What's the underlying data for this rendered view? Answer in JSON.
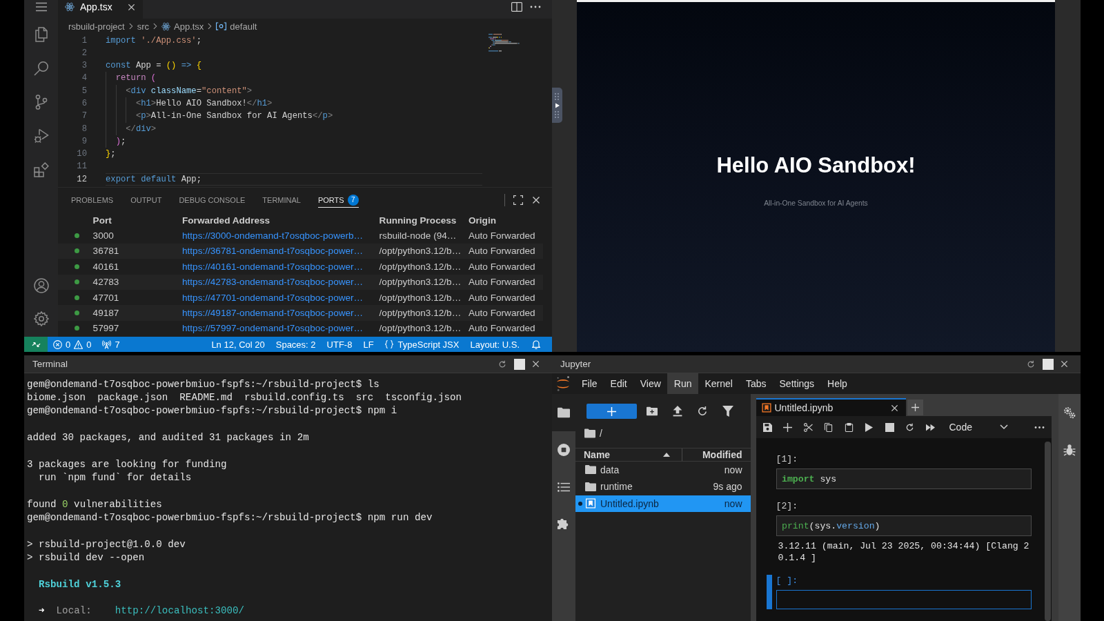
{
  "vscode": {
    "editor_tabs": [
      {
        "label": "App.tsx",
        "selected": true
      }
    ],
    "breadcrumb": [
      {
        "text": "rsbuild-project",
        "kind": "folder"
      },
      {
        "text": "src",
        "kind": "folder"
      },
      {
        "text": "App.tsx",
        "kind": "file"
      },
      {
        "text": "default",
        "kind": "symbol"
      }
    ],
    "code_lines": [
      {
        "number": "1",
        "current": false,
        "tokens": [
          {
            "text": "import",
            "kind": "keyword"
          },
          {
            "text": " './App.css'",
            "kind": "string"
          },
          {
            "text": ";",
            "kind": "plain"
          }
        ]
      },
      {
        "number": "2",
        "current": false
      },
      {
        "number": "3",
        "current": false,
        "tokens": [
          {
            "text": "const",
            "kind": "keyword"
          },
          {
            "text": " App = ",
            "kind": "plain"
          },
          {
            "text": "()",
            "kind": "bracket1"
          },
          {
            "text": " =>",
            "kind": "keyword"
          },
          {
            "text": " {",
            "kind": "bracket1"
          }
        ]
      },
      {
        "number": "4",
        "current": false,
        "tokens": [
          {
            "text": "  return",
            "kind": "control"
          },
          {
            "text": " (",
            "kind": "bracket2"
          }
        ]
      },
      {
        "number": "5",
        "current": false,
        "tokens": [
          {
            "text": "    <",
            "kind": "angle"
          },
          {
            "text": "div",
            "kind": "tag"
          },
          {
            "text": " className",
            "kind": "attr"
          },
          {
            "text": "=",
            "kind": "plain"
          },
          {
            "text": "\"content\"",
            "kind": "string"
          },
          {
            "text": ">",
            "kind": "angle"
          }
        ]
      },
      {
        "number": "6",
        "current": false,
        "tokens": [
          {
            "text": "      <",
            "kind": "angle"
          },
          {
            "text": "h1",
            "kind": "tag"
          },
          {
            "text": ">",
            "kind": "angle"
          },
          {
            "text": "Hello AIO Sandbox!",
            "kind": "plain"
          },
          {
            "text": "</",
            "kind": "angle"
          },
          {
            "text": "h1",
            "kind": "tag"
          },
          {
            "text": ">",
            "kind": "angle"
          }
        ]
      },
      {
        "number": "7",
        "current": false,
        "tokens": [
          {
            "text": "      <",
            "kind": "angle"
          },
          {
            "text": "p",
            "kind": "tag"
          },
          {
            "text": ">",
            "kind": "angle"
          },
          {
            "text": "All-in-One Sandbox for AI Agents",
            "kind": "plain"
          },
          {
            "text": "</",
            "kind": "angle"
          },
          {
            "text": "p",
            "kind": "tag"
          },
          {
            "text": ">",
            "kind": "angle"
          }
        ]
      },
      {
        "number": "8",
        "current": false,
        "tokens": [
          {
            "text": "    </",
            "kind": "angle"
          },
          {
            "text": "div",
            "kind": "tag"
          },
          {
            "text": ">",
            "kind": "angle"
          }
        ]
      },
      {
        "number": "9",
        "current": false,
        "tokens": [
          {
            "text": "  )",
            "kind": "bracket2"
          },
          {
            "text": ";",
            "kind": "plain"
          }
        ]
      },
      {
        "number": "10",
        "current": false,
        "tokens": [
          {
            "text": "}",
            "kind": "bracket1"
          },
          {
            "text": ";",
            "kind": "plain"
          }
        ]
      },
      {
        "number": "11",
        "current": false
      },
      {
        "number": "12",
        "current": true,
        "tokens": [
          {
            "text": "export default",
            "kind": "keyword"
          },
          {
            "text": " App;",
            "kind": "plain"
          }
        ]
      }
    ],
    "panel_tabs": [
      {
        "label": "PROBLEMS",
        "selected": false
      },
      {
        "label": "OUTPUT",
        "selected": false
      },
      {
        "label": "DEBUG CONSOLE",
        "selected": false
      },
      {
        "label": "TERMINAL",
        "selected": false
      },
      {
        "label": "PORTS",
        "selected": true,
        "badge": "7"
      }
    ],
    "ports_table": {
      "columns": [
        "Port",
        "Forwarded Address",
        "Running Process",
        "Origin"
      ],
      "rows": [
        {
          "port": "3000",
          "forwarded_address": "https://3000-ondemand-t7osqboc-powerb…",
          "running_process": "rsbuild-node (94…",
          "origin": "Auto Forwarded"
        },
        {
          "port": "36781",
          "forwarded_address": "https://36781-ondemand-t7osqboc-power…",
          "running_process": "/opt/python3.12/b…",
          "origin": "Auto Forwarded"
        },
        {
          "port": "40161",
          "forwarded_address": "https://40161-ondemand-t7osqboc-power…",
          "running_process": "/opt/python3.12/b…",
          "origin": "Auto Forwarded"
        },
        {
          "port": "42783",
          "forwarded_address": "https://42783-ondemand-t7osqboc-power…",
          "running_process": "/opt/python3.12/b…",
          "origin": "Auto Forwarded"
        },
        {
          "port": "47701",
          "forwarded_address": "https://47701-ondemand-t7osqboc-power…",
          "running_process": "/opt/python3.12/b…",
          "origin": "Auto Forwarded"
        },
        {
          "port": "49187",
          "forwarded_address": "https://49187-ondemand-t7osqboc-power…",
          "running_process": "/opt/python3.12/b…",
          "origin": "Auto Forwarded"
        },
        {
          "port": "57997",
          "forwarded_address": "https://57997-ondemand-t7osqboc-power…",
          "running_process": "/opt/python3.12/b…",
          "origin": "Auto Forwarded"
        }
      ]
    },
    "status_bar": {
      "errors": "0",
      "warnings": "0",
      "ports": "7",
      "items": [
        {
          "text": "Ln 12, Col 20",
          "kind": "plain"
        },
        {
          "text": "Spaces: 2",
          "kind": "plain"
        },
        {
          "text": "UTF-8",
          "kind": "plain"
        },
        {
          "text": "LF",
          "kind": "plain"
        },
        {
          "text": "TypeScript JSX",
          "kind": "language"
        },
        {
          "text": "Layout: U.S.",
          "kind": "plain"
        }
      ]
    }
  },
  "preview": {
    "heading": "Hello AIO Sandbox!",
    "subtitle": "All-in-One Sandbox for AI Agents"
  },
  "terminal": {
    "title": "Terminal",
    "blocks": [
      {
        "lines": [
          {
            "segments": [
              {
                "text": "gem@ondemand-t7osqboc-powerbmiuo-fspfs:~/rsbuild-project$ ls",
                "kind": "plain"
              }
            ]
          },
          {
            "segments": [
              {
                "text": "biome.json  package.json  README.md  rsbuild.config.ts  src  tsconfig.json",
                "kind": "plain"
              }
            ]
          },
          {
            "segments": [
              {
                "text": "gem@ondemand-t7osqboc-powerbmiuo-fspfs:~/rsbuild-project$ npm i",
                "kind": "plain"
              }
            ]
          }
        ]
      },
      {
        "lines": [
          {
            "segments": [
              {
                "text": "added 30 packages, and audited 31 packages in 2m",
                "kind": "plain"
              }
            ]
          }
        ]
      },
      {
        "lines": [
          {
            "segments": [
              {
                "text": "3 packages are looking for funding",
                "kind": "plain"
              }
            ]
          },
          {
            "segments": [
              {
                "text": "  run `npm fund` for details",
                "kind": "plain"
              }
            ]
          }
        ]
      },
      {
        "lines": [
          {
            "segments": [
              {
                "text": "found ",
                "kind": "plain"
              },
              {
                "text": "0",
                "kind": "number"
              },
              {
                "text": " vulnerabilities",
                "kind": "plain"
              }
            ]
          },
          {
            "segments": [
              {
                "text": "gem@ondemand-t7osqboc-powerbmiuo-fspfs:~/rsbuild-project$ npm run dev",
                "kind": "plain"
              }
            ]
          }
        ]
      },
      {
        "lines": [
          {
            "segments": [
              {
                "text": "> rsbuild-project@1.0.0 dev",
                "kind": "plain"
              }
            ]
          },
          {
            "segments": [
              {
                "text": "> rsbuild dev --open",
                "kind": "plain"
              }
            ]
          }
        ]
      },
      {
        "lines": [
          {
            "segments": [
              {
                "text": "  Rsbuild v1.5.3",
                "kind": "heading"
              }
            ]
          }
        ]
      },
      {
        "lines": [
          {
            "segments": [
              {
                "text": "  ➜",
                "kind": "arrow"
              },
              {
                "text": "  Local:",
                "kind": "label"
              },
              {
                "text": "    http://localhost:3000/",
                "kind": "url"
              }
            ]
          }
        ]
      }
    ]
  },
  "jupyter": {
    "title": "Jupyter",
    "menu": [
      {
        "label": "File",
        "selected": false
      },
      {
        "label": "Edit",
        "selected": false
      },
      {
        "label": "View",
        "selected": false
      },
      {
        "label": "Run",
        "selected": true
      },
      {
        "label": "Kernel",
        "selected": false
      },
      {
        "label": "Tabs",
        "selected": false
      },
      {
        "label": "Settings",
        "selected": false
      },
      {
        "label": "Help",
        "selected": false
      }
    ],
    "left_sidebar_tabs": [
      {
        "selected": true
      },
      {
        "selected": false
      },
      {
        "selected": false
      },
      {
        "selected": false
      }
    ],
    "file_browser": {
      "path": "/",
      "columns": [
        {
          "label": "Name",
          "sorted": true
        },
        {
          "label": "Modified",
          "sorted": false
        }
      ],
      "items": [
        {
          "name": "data",
          "modified": "now",
          "kind": "folder",
          "selected": false,
          "running": false
        },
        {
          "name": "runtime",
          "modified": "9s ago",
          "kind": "folder",
          "selected": false,
          "running": false
        },
        {
          "name": "Untitled.ipynb",
          "modified": "now",
          "kind": "notebook",
          "selected": true,
          "running": true
        }
      ]
    },
    "notebook_tabs": [
      {
        "label": "Untitled.ipynb",
        "selected": true
      }
    ],
    "cell_type": "Code",
    "cells": [
      {
        "prompt": "[1]:",
        "active": false,
        "code": [
          {
            "text": "import",
            "kind": "keyword"
          },
          {
            "text": " sys",
            "kind": "plain"
          }
        ]
      },
      {
        "prompt": "[2]:",
        "active": false,
        "code": [
          {
            "text": "print",
            "kind": "builtin"
          },
          {
            "text": "(sys.",
            "kind": "plain"
          },
          {
            "text": "version",
            "kind": "attr"
          },
          {
            "text": ")",
            "kind": "plain"
          }
        ],
        "output": "3.12.11 (main, Jul 23 2025, 00:34:44) [Clang 20.1.4 ]"
      },
      {
        "prompt": "[ ]:",
        "active": true
      }
    ]
  }
}
